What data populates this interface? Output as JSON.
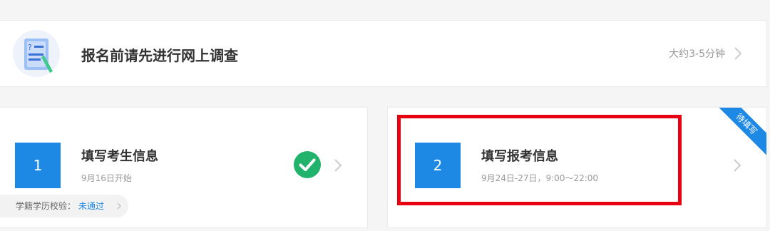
{
  "survey": {
    "title": "报名前请先进行网上调查",
    "duration": "大约3-5分钟",
    "icon": "questionnaire-icon"
  },
  "steps": [
    {
      "number": "1",
      "title": "填写考生信息",
      "date": "9月16日开始",
      "status_icon": "check-circle-icon",
      "verification": {
        "label": "学籍学历校验：",
        "status": "未通过"
      }
    },
    {
      "number": "2",
      "title": "填写报考信息",
      "date": "9月24日-27日，9:00～22:00",
      "badge": "待填写"
    }
  ],
  "colors": {
    "accent": "#1e88e5",
    "success": "#21b36b",
    "highlight": "#e60012"
  }
}
